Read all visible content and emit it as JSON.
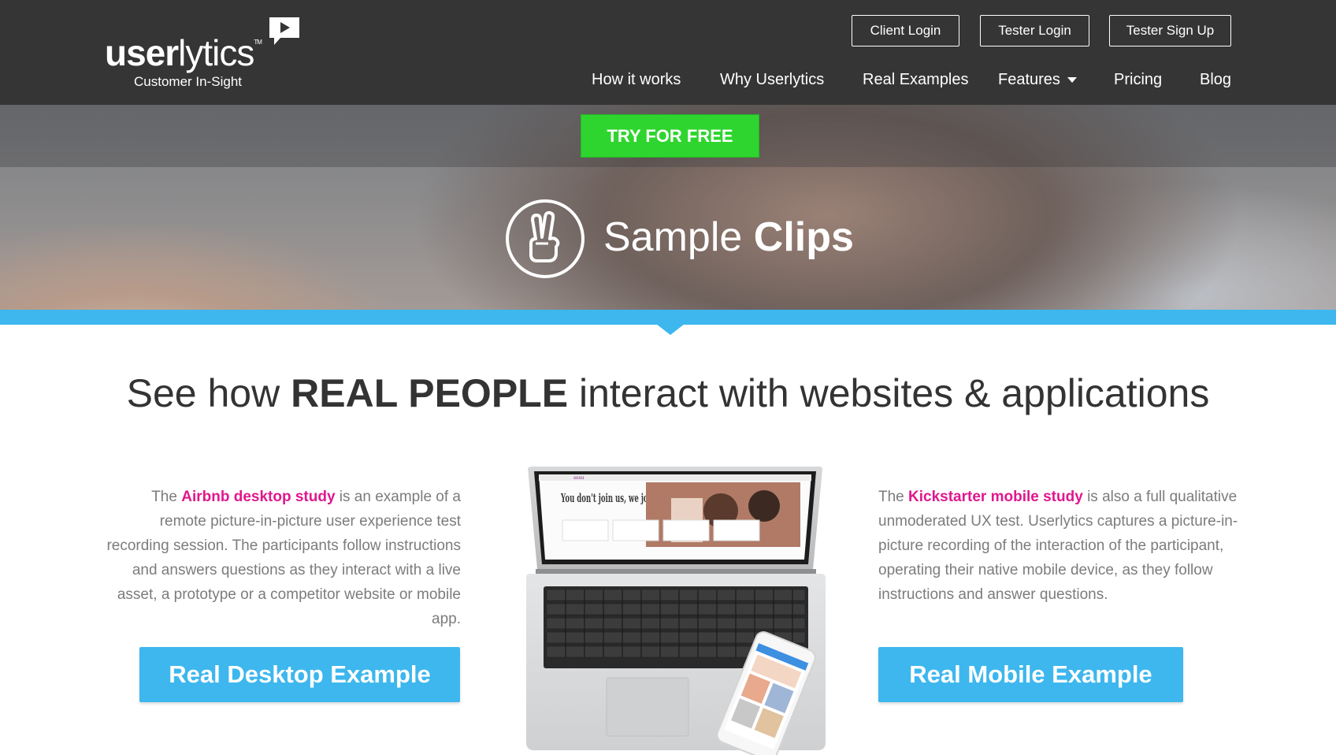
{
  "brand": {
    "name_bold": "user",
    "name_light": "lytics",
    "tm": "TM",
    "tagline": "Customer In-Sight"
  },
  "top_buttons": {
    "client_login": "Client Login",
    "tester_login": "Tester Login",
    "tester_signup": "Tester Sign Up"
  },
  "nav": {
    "how_it_works": "How it works",
    "why": "Why Userlytics",
    "examples": "Real Examples",
    "features": "Features",
    "pricing": "Pricing",
    "blog": "Blog"
  },
  "hero": {
    "cta": "TRY FOR FREE",
    "title_light": "Sample",
    "title_bold": "Clips"
  },
  "headline": {
    "part1": "See how",
    "bold": "REAL PEOPLE",
    "part2": "interact with websites & applications"
  },
  "left_text": {
    "lead": "The",
    "highlight": "Airbnb desktop study",
    "body": "is an example of a remote picture-in-picture user experience test recording session. The participants follow instructions and answers questions as they interact with a live asset, a prototype or a competitor website or mobile app."
  },
  "right_text": {
    "lead": "The",
    "highlight": "Kickstarter mobile study",
    "body": "is also a full qualitative unmoderated UX test. Userlytics captures a picture-in-picture recording of the interaction of the participant, operating their native mobile device, as they follow instructions and answer questions."
  },
  "buttons": {
    "desktop": "Real Desktop Example",
    "mobile": "Real Mobile Example"
  },
  "laptop_screen": {
    "headline": "You don't join us, we join you"
  },
  "colors": {
    "header_bg": "#353535",
    "accent_blue": "#3db7ee",
    "cta_green": "#2fd52f",
    "highlight_pink": "#e0178e"
  }
}
